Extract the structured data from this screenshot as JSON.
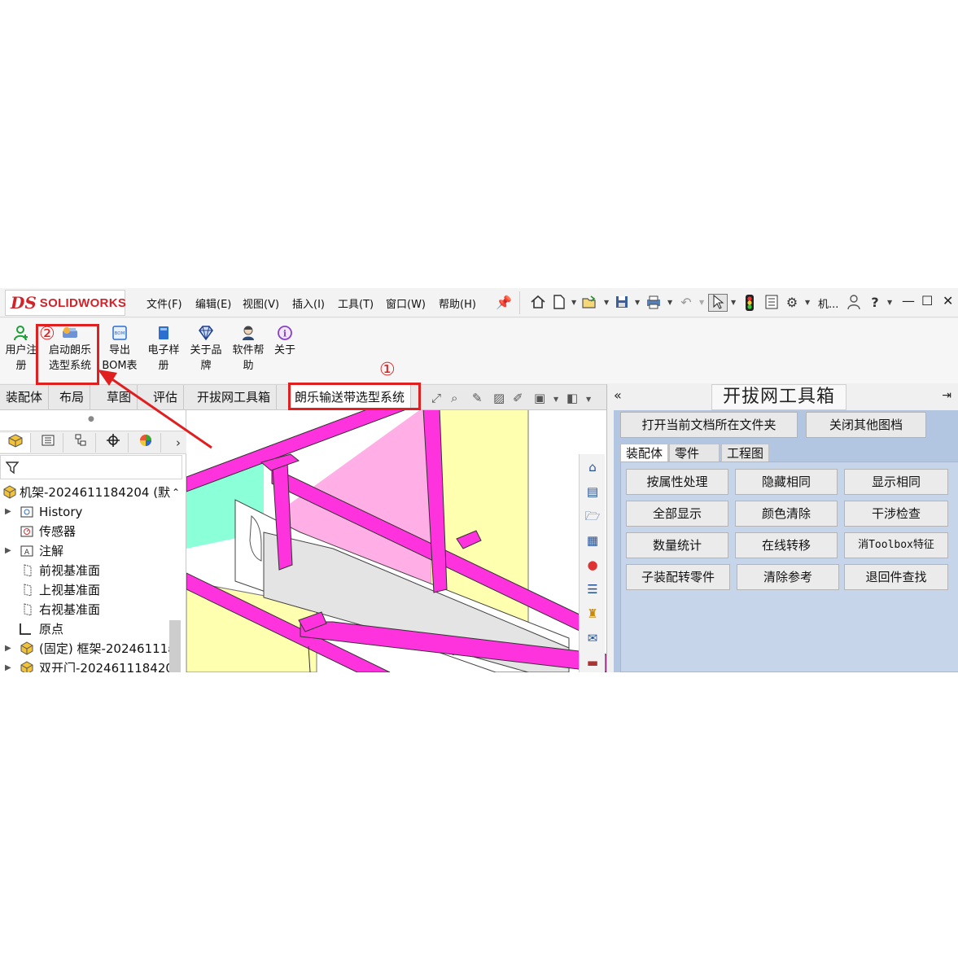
{
  "app": {
    "logo_prefix": "DS",
    "logo_text": "SOLIDWORKS"
  },
  "menu": {
    "items": [
      "文件(F)",
      "编辑(E)",
      "视图(V)",
      "插入(I)",
      "工具(T)",
      "窗口(W)",
      "帮助(H)"
    ],
    "search_label": "机..."
  },
  "toolbar_icons": [
    "pin-icon",
    "home-icon",
    "new-document-icon",
    "open-icon",
    "save-icon",
    "print-icon",
    "undo-icon",
    "select-icon",
    "traffic-light-icon",
    "file-properties-icon",
    "options-icon",
    "user-icon",
    "help-icon",
    "minimize-icon",
    "maximize-icon",
    "close-icon"
  ],
  "commands": [
    {
      "label_line1": "用户注",
      "label_line2": "册",
      "icon": "user-add-icon"
    },
    {
      "label_line1": "启动朗乐",
      "label_line2": "选型系统",
      "icon": "launch-system-icon"
    },
    {
      "label_line1": "导出",
      "label_line2": "BOM表",
      "icon": "bom-icon"
    },
    {
      "label_line1": "电子样",
      "label_line2": "册",
      "icon": "ebook-icon"
    },
    {
      "label_line1": "关于品",
      "label_line2": "牌",
      "icon": "diamond-icon"
    },
    {
      "label_line1": "软件帮",
      "label_line2": "助",
      "icon": "support-person-icon"
    },
    {
      "label_line1": "关于",
      "label_line2": "",
      "icon": "info-icon"
    }
  ],
  "tabs": [
    "装配体",
    "布局",
    "草图",
    "评估",
    "开拔网工具箱",
    "朗乐输送带选型系统"
  ],
  "active_tab": "朗乐输送带选型系统",
  "feature_tree": {
    "root": "机架-2024611184204  (默",
    "items": [
      {
        "label": "History",
        "icon": "history-icon",
        "expandable": true
      },
      {
        "label": "传感器",
        "icon": "sensor-icon",
        "expandable": false
      },
      {
        "label": "注解",
        "icon": "annotation-icon",
        "expandable": true
      },
      {
        "label": "前视基准面",
        "icon": "plane-icon",
        "expandable": false
      },
      {
        "label": "上视基准面",
        "icon": "plane-icon",
        "expandable": false
      },
      {
        "label": "右视基准面",
        "icon": "plane-icon",
        "expandable": false
      },
      {
        "label": "原点",
        "icon": "origin-icon",
        "expandable": false
      },
      {
        "label": "(固定) 框架-20246111ε",
        "icon": "part-icon",
        "expandable": true
      },
      {
        "label": "双开门-202461118420",
        "icon": "part-icon",
        "expandable": true
      }
    ]
  },
  "task_pane": {
    "title": "开拔网工具箱",
    "top_buttons": [
      "打开当前文档所在文件夹",
      "关闭其他图档"
    ],
    "tabs": [
      "装配体",
      "零件",
      "工程图"
    ],
    "active_tab": "装配体",
    "buttons": [
      [
        "按属性处理",
        "隐藏相同",
        "显示相同"
      ],
      [
        "全部显示",
        "颜色清除",
        "干涉检查"
      ],
      [
        "数量统计",
        "在线转移",
        "消Toolbox特征"
      ],
      [
        "子装配转零件",
        "清除参考",
        "退回件查找"
      ]
    ]
  },
  "annotations": {
    "marker1": "①",
    "marker2": "②",
    "color": "#e02020"
  },
  "colors": {
    "frame_magenta": "#ff33dd",
    "panel_yellow": "#ffffb0",
    "panel_pink": "#ffaee6",
    "panel_mint": "#8affd8",
    "task_pane_blue": "#b3c6e1",
    "accent_red": "#d2232a"
  }
}
